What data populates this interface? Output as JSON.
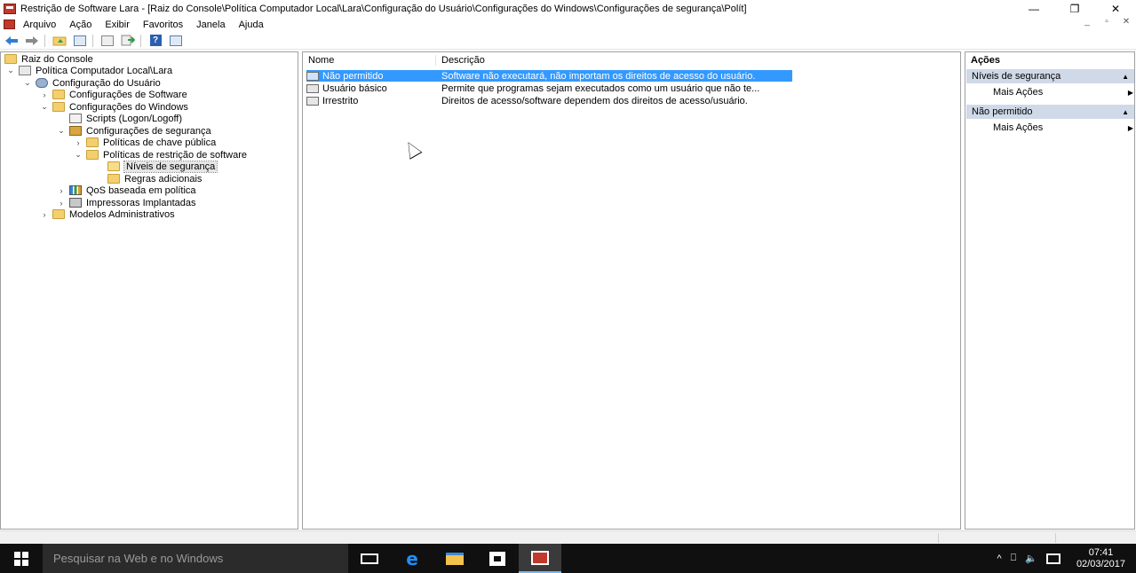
{
  "window": {
    "title": "Restrição de Software Lara - [Raiz do Console\\Política Computador Local\\Lara\\Configuração do Usuário\\Configurações do Windows\\Configurações de segurança\\Polít]",
    "controls": {
      "minimize": "—",
      "restore": "❐",
      "close": "✕"
    }
  },
  "menu": {
    "items": [
      "Arquivo",
      "Ação",
      "Exibir",
      "Favoritos",
      "Janela",
      "Ajuda"
    ],
    "child_controls": [
      "_",
      "▫",
      "✕"
    ]
  },
  "toolbar": {
    "buttons": [
      "back-icon",
      "forward-icon",
      "up-folder-icon",
      "show-hide-tree-icon",
      "properties-icon",
      "export-list-icon",
      "help-icon",
      "show-hide-action-pane-icon"
    ],
    "help_glyph": "?"
  },
  "tree": {
    "items": [
      {
        "label": "Raiz do Console",
        "icon": "folder-icon",
        "expander": ""
      },
      {
        "label": "Política Computador Local\\Lara",
        "icon": "policy-icon",
        "expander": "⌄"
      },
      {
        "label": "Configuração do Usuário",
        "icon": "user-config-icon",
        "expander": "⌄"
      },
      {
        "label": "Configurações de Software",
        "icon": "folder-icon",
        "expander": "›"
      },
      {
        "label": "Configurações do Windows",
        "icon": "folder-icon",
        "expander": "⌄"
      },
      {
        "label": "Scripts (Logon/Logoff)",
        "icon": "script-icon",
        "expander": ""
      },
      {
        "label": "Configurações de segurança",
        "icon": "security-icon",
        "expander": "⌄"
      },
      {
        "label": "Políticas de chave pública",
        "icon": "folder-icon",
        "expander": "›"
      },
      {
        "label": "Políticas de restrição de software",
        "icon": "folder-icon",
        "expander": "⌄"
      },
      {
        "label": "Níveis de segurança",
        "icon": "folder-open-icon",
        "expander": ""
      },
      {
        "label": "Regras adicionais",
        "icon": "folder-icon",
        "expander": ""
      },
      {
        "label": "QoS baseada em política",
        "icon": "chart-icon",
        "expander": "›"
      },
      {
        "label": "Impressoras Implantadas",
        "icon": "printer-icon",
        "expander": "›"
      },
      {
        "label": "Modelos Administrativos",
        "icon": "folder-icon",
        "expander": "›"
      }
    ]
  },
  "list": {
    "columns": {
      "name": "Nome",
      "description": "Descrição"
    },
    "rows": [
      {
        "name": "Não permitido",
        "description": "Software não executará, não importam os direitos de acesso do usuário."
      },
      {
        "name": "Usuário básico",
        "description": "Permite que programas sejam executados como um usuário que não te..."
      },
      {
        "name": "Irrestrito",
        "description": "Direitos de acesso/software dependem dos direitos de acesso/usuário."
      }
    ]
  },
  "actions": {
    "title": "Ações",
    "sections": [
      {
        "header": "Níveis de segurança",
        "item": "Mais Ações"
      },
      {
        "header": "Não permitido",
        "item": "Mais Ações"
      }
    ]
  },
  "taskbar": {
    "search_placeholder": "Pesquisar na Web e no Windows",
    "edge_glyph": "e",
    "tray_icons": [
      "^",
      "⎕",
      "🔈"
    ],
    "time": "07:41",
    "date": "02/03/2017"
  }
}
